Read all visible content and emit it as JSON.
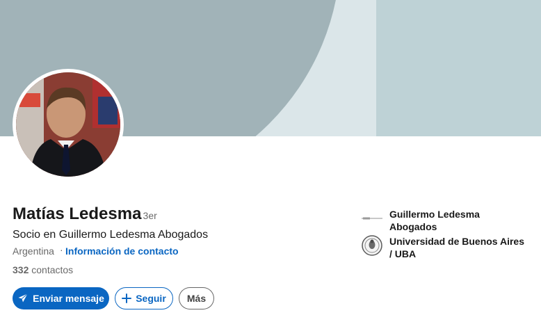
{
  "profile": {
    "name": "Matías Ledesma",
    "degree": "· 3er",
    "headline": "Socio en Guillermo Ledesma Abogados",
    "location": "Argentina",
    "separator": "·",
    "contact_info": "Información de contacto",
    "connections_count": "332",
    "connections_label": "contactos"
  },
  "actions": {
    "message": "Enviar mensaje",
    "follow": "Seguir",
    "more": "Más"
  },
  "organizations": [
    {
      "name": "Guillermo Ledesma Abogados",
      "icon": "company-logo-icon"
    },
    {
      "name": "Universidad de Buenos Aires / UBA",
      "icon": "university-seal-icon"
    }
  ],
  "colors": {
    "primary": "#0a66c2",
    "banner_light": "#dbe6e9",
    "banner_mid": "#bed2d6",
    "banner_dark": "#a1b3b8"
  }
}
